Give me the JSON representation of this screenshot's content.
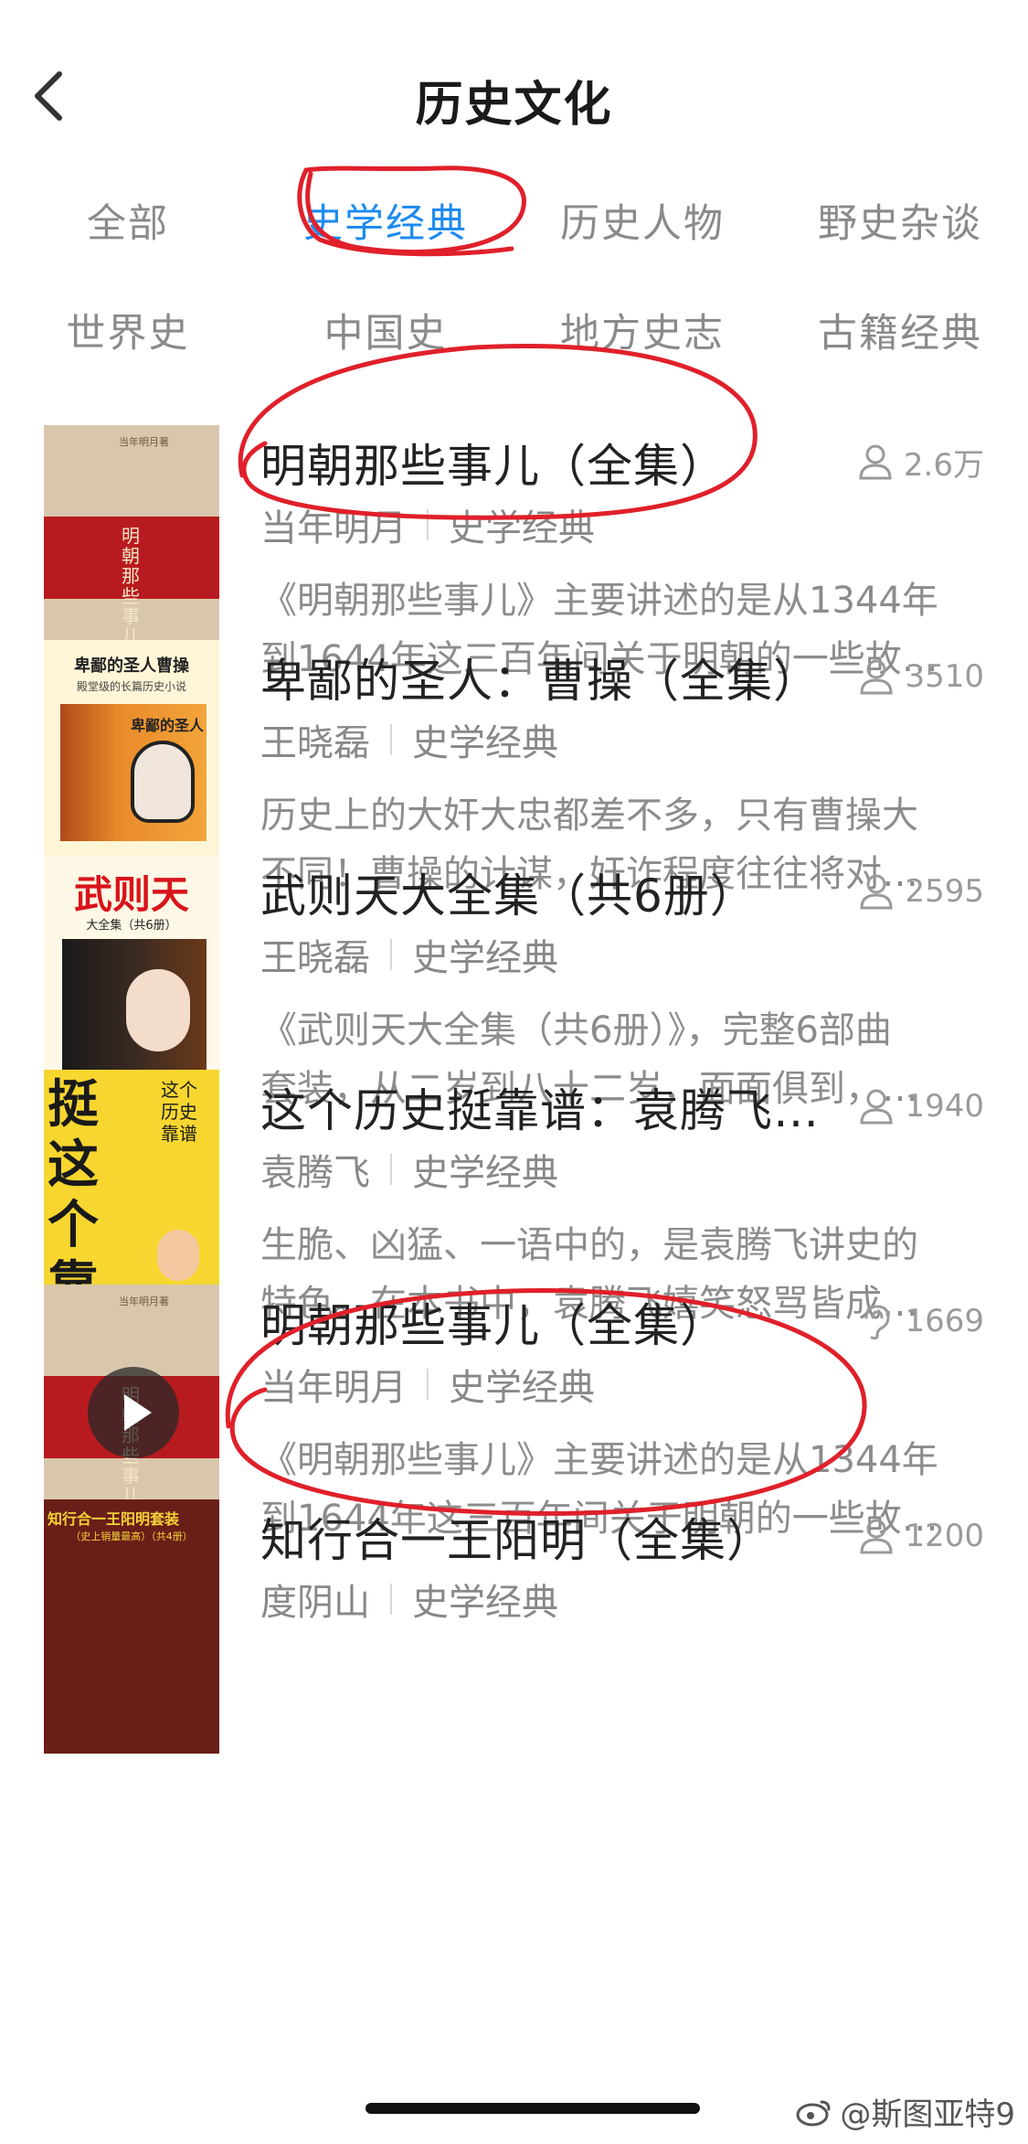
{
  "header": {
    "title": "历史文化"
  },
  "categories": [
    [
      "全部",
      "史学经典",
      "历史人物",
      "野史杂谈"
    ],
    [
      "世界史",
      "中国史",
      "地方史志",
      "古籍经典"
    ]
  ],
  "active_category": "史学经典",
  "items": [
    {
      "title": "明朝那些事儿（全集）",
      "plays": "2.6万",
      "author": "当年明月",
      "category": "史学经典",
      "desc_line1": "《明朝那些事儿》主要讲述的是从1344年",
      "desc_line2": "到1644年这三百年间关于明朝的一些故…",
      "cover": {
        "title": "明朝那些事儿",
        "author": "当年明月著"
      }
    },
    {
      "title": "卑鄙的圣人：曹操（全集）",
      "plays": "3510",
      "author": "王晓磊",
      "category": "史学经典",
      "desc_line1": "历史上的大奸大忠都差不多，只有曹操大",
      "desc_line2": "不同！曹操的计谋，奸诈程度往往将对…",
      "cover": {
        "title": "卑鄙的圣人曹操",
        "subtitle": "殿堂级的长篇历史小说",
        "box_title": "卑鄙的圣人"
      }
    },
    {
      "title": "武则天大全集（共6册）",
      "plays": "2595",
      "author": "王晓磊",
      "category": "史学经典",
      "desc_line1": "《武则天大全集（共6册）》，完整6部曲",
      "desc_line2": "套装，从二岁到八十二岁，面面俱到，…",
      "cover": {
        "title": "武则天",
        "subtitle": "大全集（共6册）"
      }
    },
    {
      "title": "这个历史挺靠谱：袁腾飞…",
      "plays": "1940",
      "author": "袁腾飞",
      "category": "史学经典",
      "desc_line1": "生脆、凶猛、一语中的，是袁腾飞讲史的",
      "desc_line2": "特色。在本书中，袁腾飞嬉笑怒骂皆成…",
      "cover": {
        "big": "挺这个靠历谱史",
        "small": "这个历史靠谱"
      }
    },
    {
      "title": "明朝那些事儿（全集）",
      "plays": "1669",
      "author": "当年明月",
      "category": "史学经典",
      "desc_line1": "《明朝那些事儿》主要讲述的是从1344年",
      "desc_line2": "到1644年这三百年间关于明朝的一些故…",
      "cover": {
        "title": "明朝那些事儿",
        "author": "当年明月著"
      }
    },
    {
      "title": "知行合一王阳明（全集）",
      "plays": "1200",
      "author": "度阴山",
      "category": "史学经典",
      "desc_line1": "",
      "desc_line2": "",
      "cover": {
        "title": "知行合一王阳明套装",
        "subtitle": "（史上销量最高）（共4册）"
      }
    }
  ],
  "watermark": "@斯图亚特9",
  "colors": {
    "accent": "#1e8bf0",
    "annotation": "#e0202a",
    "title": "#222222",
    "meta": "#888888"
  }
}
